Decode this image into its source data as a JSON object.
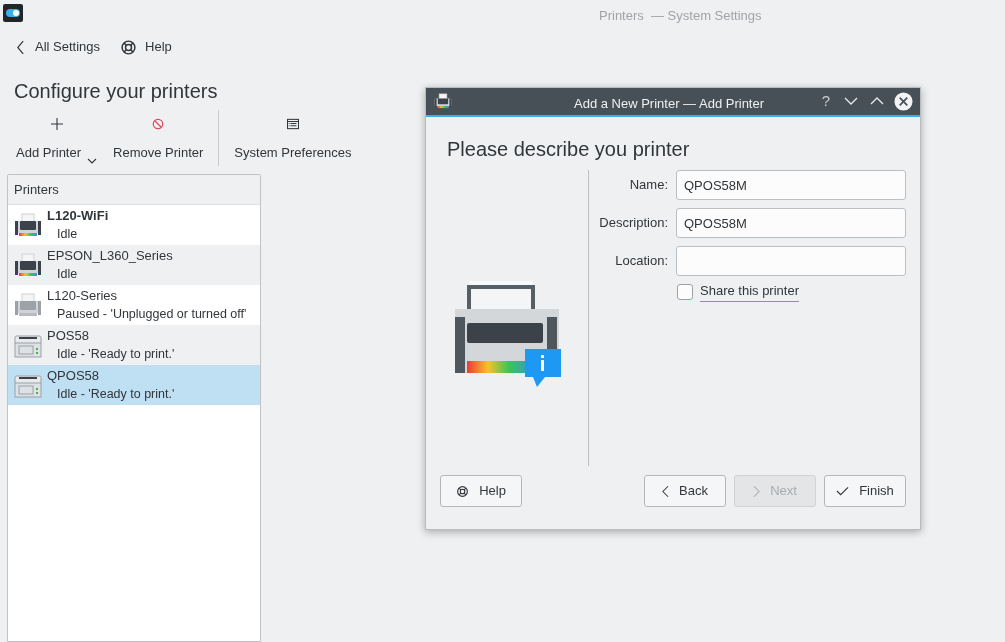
{
  "window": {
    "title": "Printers  — System Settings"
  },
  "nav": {
    "back": "All Settings",
    "help": "Help"
  },
  "heading": "Configure your printers",
  "toolbar": [
    {
      "kind": "add",
      "label": "Add Printer",
      "dropdown": true
    },
    {
      "kind": "remove",
      "label": "Remove Printer",
      "dropdown": false
    },
    {
      "kind": "prefs",
      "label": "System Preferences",
      "dropdown": false
    }
  ],
  "printers": {
    "header": "Printers",
    "items": [
      {
        "kind": "inkjet",
        "name": "L120-WiFi",
        "status": "Idle",
        "default": true,
        "paused": false,
        "selected": false
      },
      {
        "kind": "inkjet",
        "name": "EPSON_L360_Series",
        "status": "Idle",
        "default": false,
        "paused": false,
        "selected": false
      },
      {
        "kind": "inkjet",
        "name": "L120-Series",
        "status": "Paused - 'Unplugged or turned off'",
        "default": false,
        "paused": true,
        "selected": false
      },
      {
        "kind": "receipt",
        "name": "POS58",
        "status": "Idle - 'Ready to print.'",
        "default": false,
        "paused": false,
        "selected": false
      },
      {
        "kind": "receipt",
        "name": "QPOS58",
        "status": "Idle - 'Ready to print.'",
        "default": false,
        "paused": false,
        "selected": true
      }
    ]
  },
  "dialog": {
    "title": "Add a New Printer — Add Printer",
    "title_buttons": [
      "?"
    ],
    "heading": "Please describe you printer",
    "fields": [
      {
        "label": "Name:",
        "value": "QPOS58M"
      },
      {
        "label": "Description:",
        "value": "QPOS58M"
      },
      {
        "label": "Location:"
      }
    ],
    "share": {
      "label": "Share this printer",
      "checked": false
    },
    "buttons": [
      {
        "kind": "help",
        "label": "Help",
        "disabled": false
      },
      {
        "kind": "back",
        "label": "Back",
        "disabled": false
      },
      {
        "kind": "next",
        "label": "Next",
        "disabled": true
      },
      {
        "kind": "finish",
        "label": "Finish",
        "disabled": false
      }
    ]
  }
}
